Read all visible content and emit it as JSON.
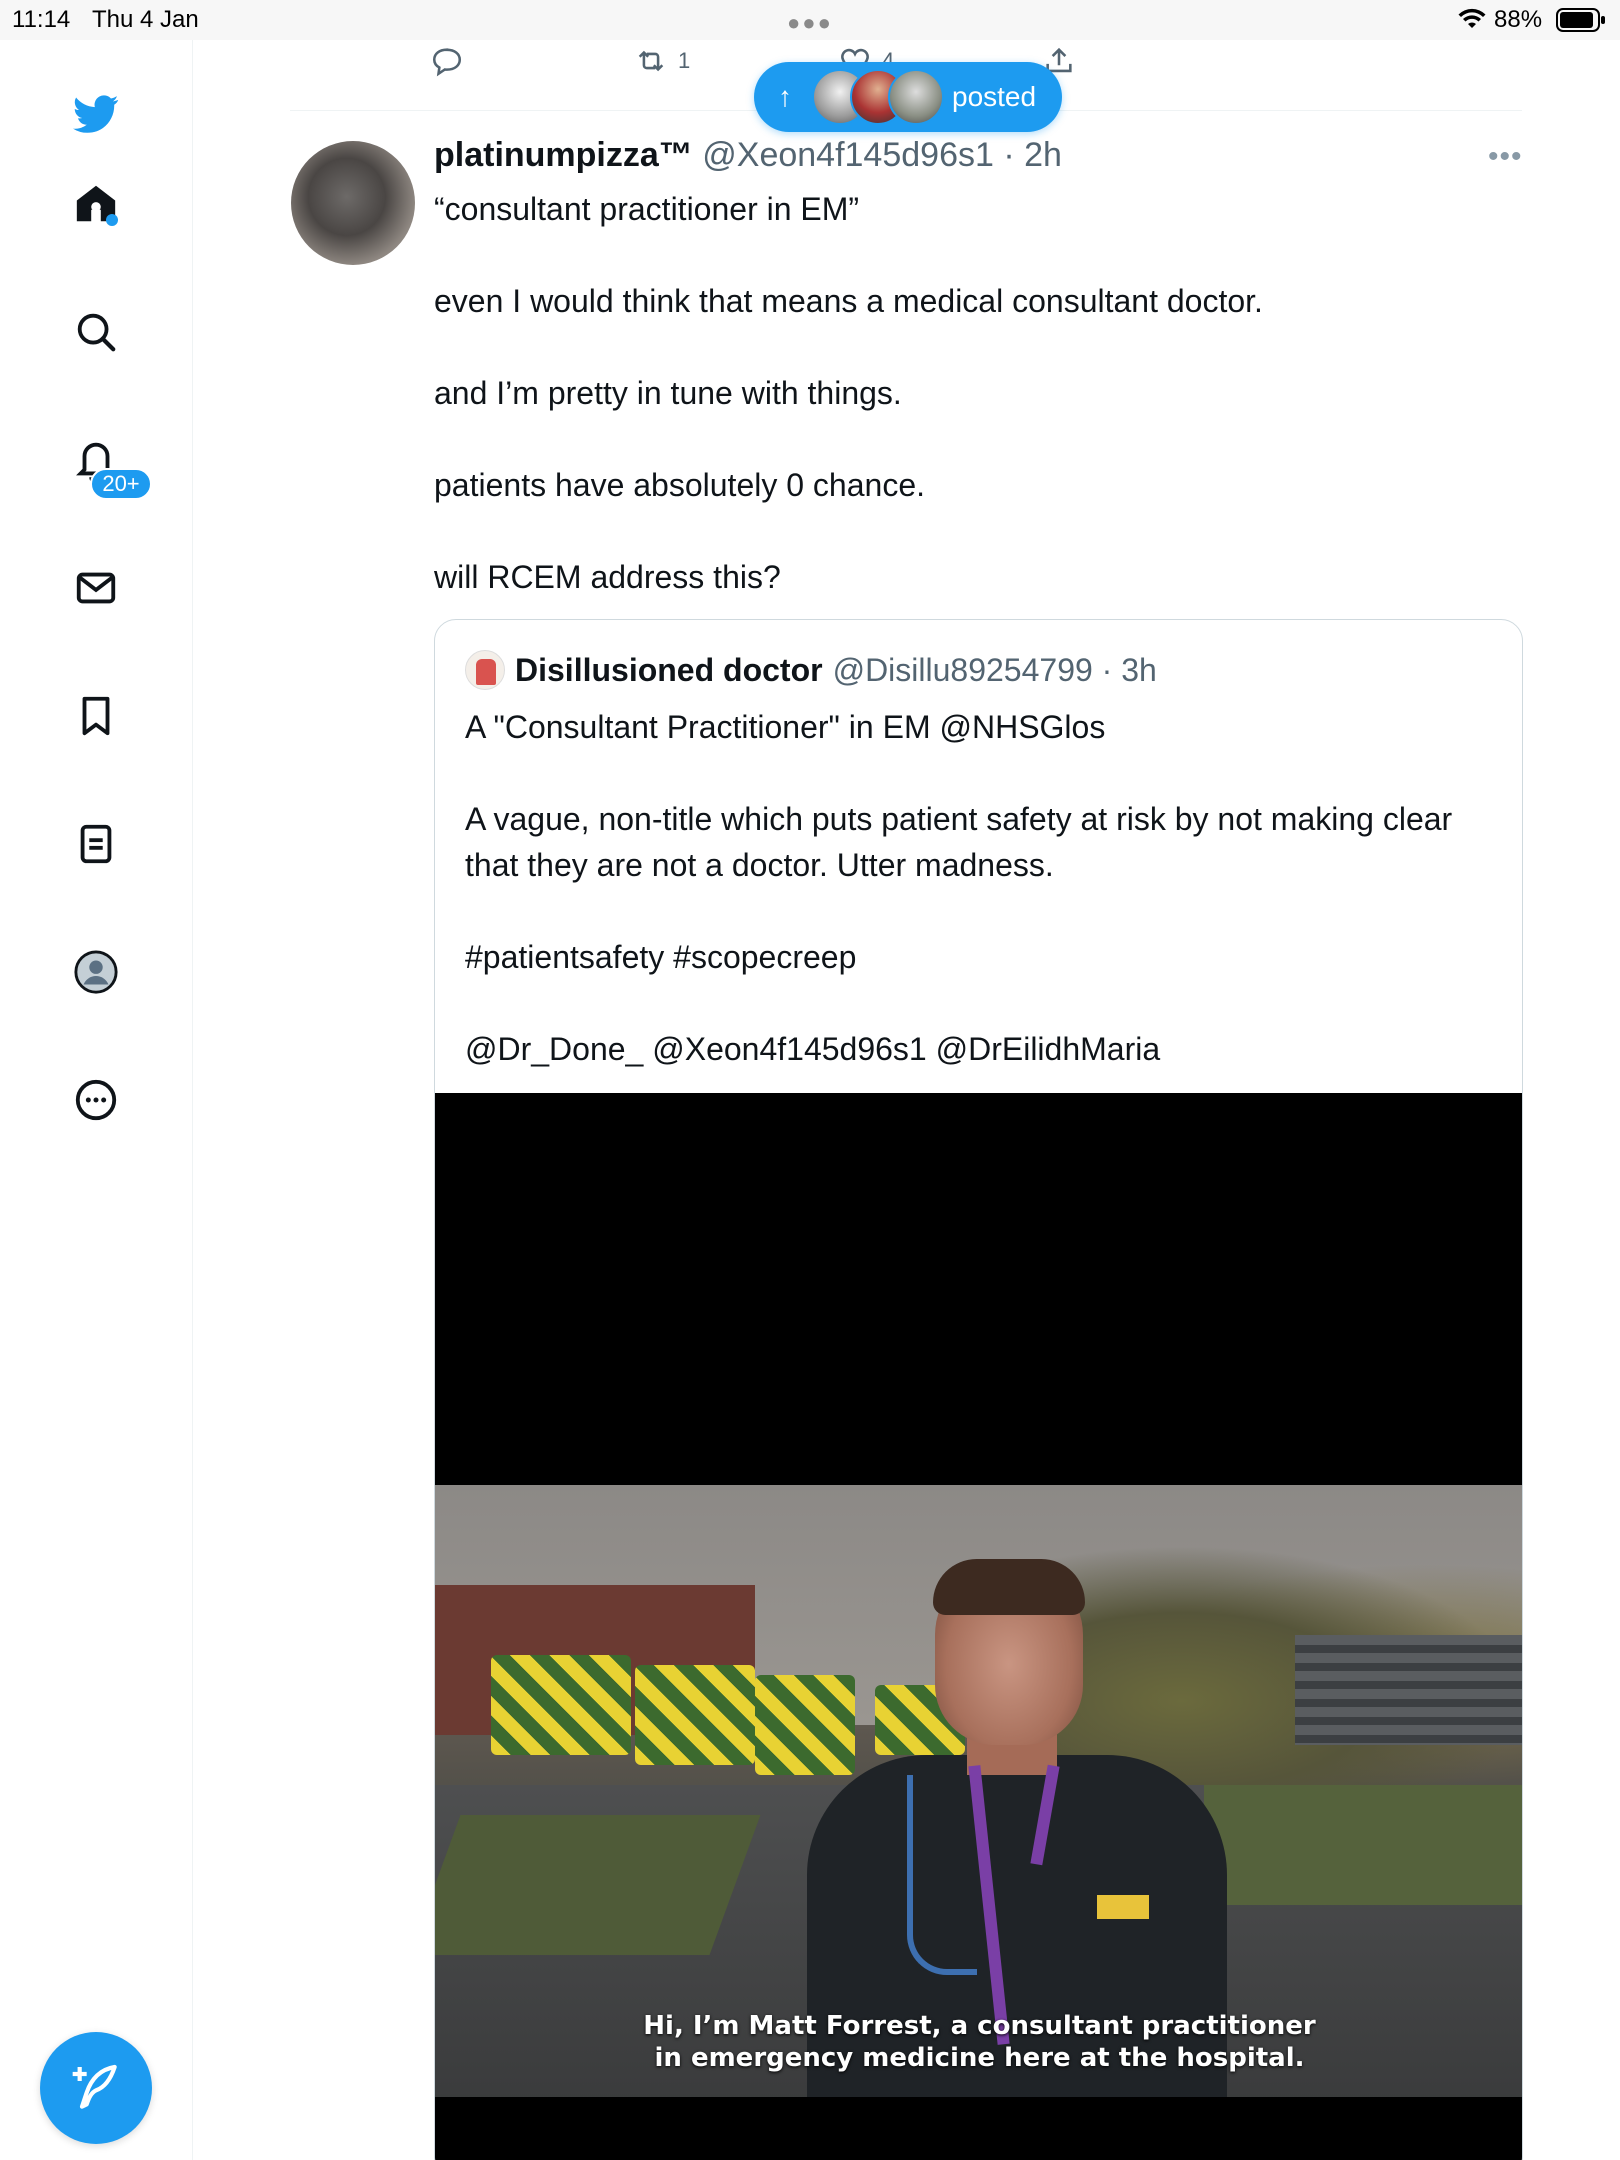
{
  "status_bar": {
    "time": "11:14",
    "date": "Thu 4 Jan",
    "battery": "88%"
  },
  "sidebar": {
    "notifications_badge": "20+"
  },
  "previous_tweet": {
    "retweet_count": "1",
    "like_count": "4"
  },
  "posted_pill": {
    "label": "posted"
  },
  "tweet": {
    "author_name": "platinumpizza™",
    "author_handle": "@Xeon4f145d96s1 · 2h",
    "lines": [
      "“consultant practitioner in EM”",
      "even I would think that means a medical consultant doctor.",
      "and I’m pretty in tune with things.",
      "patients have absolutely 0 chance.",
      "will RCEM address this?"
    ]
  },
  "quoted_tweet": {
    "author_name": "Disillusioned doctor",
    "author_handle": "@Disillu89254799 · 3h",
    "paragraphs": [
      "A \"Consultant Practitioner\" in EM @NHSGlos",
      "A vague, non-title which puts patient safety at risk by not making clear that they are not a doctor. Utter madness.",
      "#patientsafety #scopecreep",
      "@Dr_Done_ @Xeon4f145d96s1 @DrEilidhMaria"
    ],
    "video_subtitle": [
      "Hi, I’m Matt Forrest, a consultant practitioner",
      "in emergency medicine here at the hospital."
    ]
  },
  "colors": {
    "accent": "#1d9bf0",
    "text_primary": "#0f1419",
    "text_secondary": "#536471"
  }
}
